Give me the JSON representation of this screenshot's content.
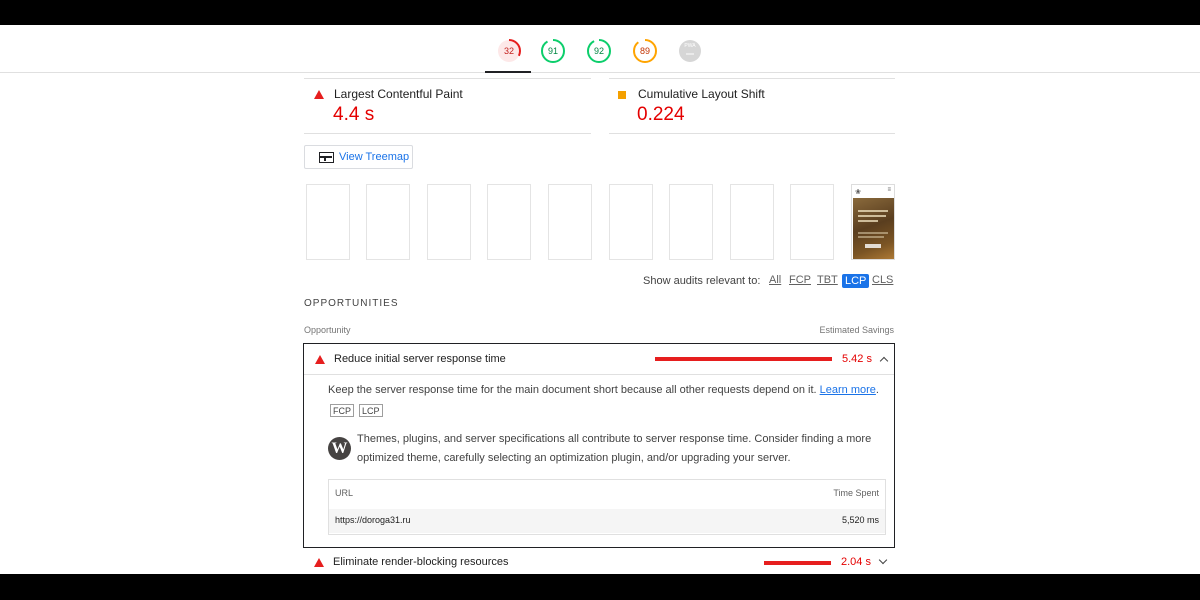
{
  "gauges": [
    {
      "label": "32",
      "score": 0.32,
      "color": "#e61e1e",
      "bg": "#fde8e8"
    },
    {
      "label": "91",
      "score": 0.91,
      "color": "#0cce6b",
      "bg": "#ffffff"
    },
    {
      "label": "92",
      "score": 0.92,
      "color": "#0cce6b",
      "bg": "#ffffff"
    },
    {
      "label": "89",
      "score": 0.89,
      "color": "#ffa400",
      "bg": "#ffffff"
    },
    {
      "label": "PWA",
      "score": 0,
      "color": "#c4c4c4",
      "bg": "#d6d6d6"
    }
  ],
  "metrics": {
    "lcp": {
      "label": "Largest Contentful Paint",
      "value": "4.4 s",
      "status_color": "#e61e1e"
    },
    "cls": {
      "label": "Cumulative Layout Shift",
      "value": "0.224",
      "status_color": "#f4a000"
    }
  },
  "treemap": {
    "label": "View Treemap",
    "icon": "treemap-icon"
  },
  "filmstrip": {
    "frames_blank": 9,
    "last_frame_icon": "site-screenshot"
  },
  "filter": {
    "label": "Show audits relevant to:",
    "chips": [
      "All",
      "FCP",
      "TBT",
      "LCP",
      "CLS"
    ],
    "active": "LCP"
  },
  "opportunities": {
    "section_title": "OPPORTUNITIES",
    "col_opportunity": "Opportunity",
    "col_savings": "Estimated Savings",
    "audits": [
      {
        "title": "Reduce initial server response time",
        "savings": "5.42 s",
        "bar_fraction": 1.0,
        "expanded": true,
        "description": "Keep the server response time for the main document short because all other requests depend on it.",
        "learn_more": "Learn more",
        "tags": [
          "FCP",
          "LCP"
        ],
        "wp_note_line1": "Themes, plugins, and server specifications all contribute to server response time. Consider finding a more",
        "wp_note_line2": "optimized theme, carefully selecting an optimization plugin, and/or upgrading your server.",
        "table": {
          "headers": [
            "URL",
            "Time Spent"
          ],
          "rows": [
            [
              "https://doroga31.ru",
              "5,520 ms"
            ]
          ]
        }
      },
      {
        "title": "Eliminate render-blocking resources",
        "savings": "2.04 s",
        "bar_fraction": 0.376,
        "expanded": false
      }
    ]
  }
}
